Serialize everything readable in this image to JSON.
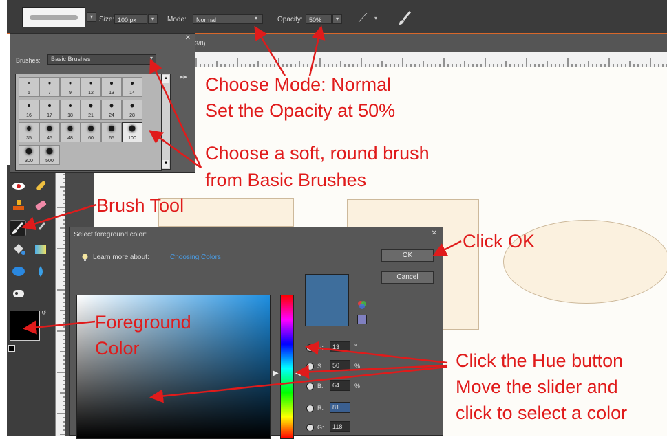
{
  "options_bar": {
    "size_label": "Size:",
    "size_value": "100 px",
    "mode_label": "Mode:",
    "mode_value": "Normal",
    "opacity_label": "Opacity:",
    "opacity_value": "50%"
  },
  "document": {
    "tab_fragment": "3/8)"
  },
  "brushes_panel": {
    "label": "Brushes:",
    "set_value": "Basic Brushes",
    "sizes": [
      "5",
      "7",
      "9",
      "12",
      "13",
      "14",
      "16",
      "17",
      "18",
      "21",
      "24",
      "28",
      "35",
      "45",
      "48",
      "60",
      "65",
      "100",
      "300",
      "500"
    ]
  },
  "color_dialog": {
    "title": "Select foreground color:",
    "learn_more_label": "Learn more about:",
    "learn_more_link": "Choosing Colors",
    "ok_label": "OK",
    "cancel_label": "Cancel",
    "h_label": "H:",
    "h_value": "13",
    "h_unit": "°",
    "s_label": "S:",
    "s_value": "50",
    "s_unit": "%",
    "b_label": "B:",
    "b_value": "64",
    "b_unit": "%",
    "r_label": "R:",
    "r_value": "81",
    "g_label": "G:",
    "g_value": "118",
    "preview_color": "#3e6e9c",
    "field_color": "#1d8ee0"
  },
  "annotations": {
    "mode": "Choose Mode: Normal",
    "opacity": "Set the Opacity at 50%",
    "brush_line1": "Choose a soft, round brush",
    "brush_line2": "from Basic Brushes",
    "brush_tool": "Brush Tool",
    "click_ok": "Click OK",
    "fg_line1": "Foreground",
    "fg_line2": "Color",
    "hue_line1": "Click the Hue button",
    "hue_line2": "Move the slider and",
    "hue_line3": "click to select a color",
    "color": "#e01b1b"
  }
}
